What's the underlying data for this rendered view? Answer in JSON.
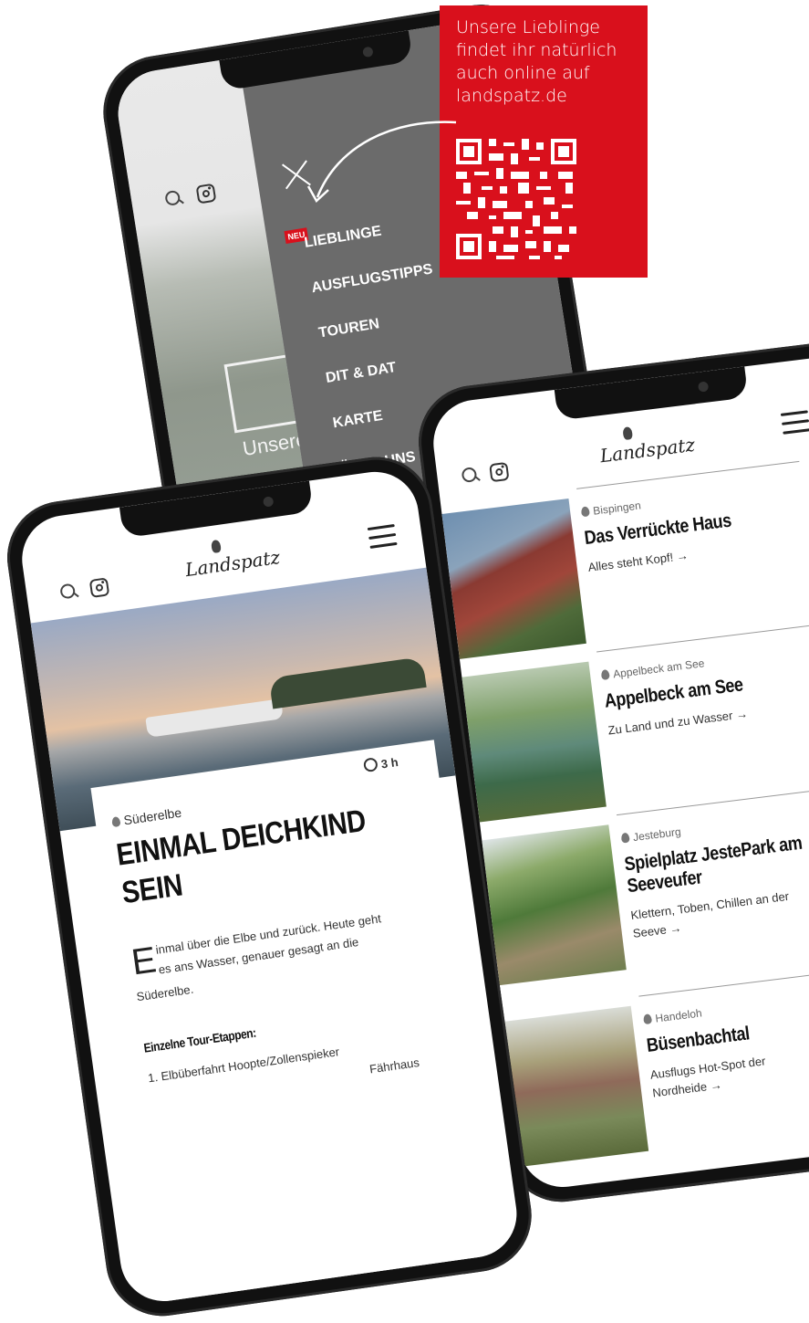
{
  "promo": {
    "text_lines": [
      "Unsere Lieblinge",
      "findet ihr natürlich",
      "auch online auf",
      "landspatz.de"
    ],
    "bg_color": "#d9101c"
  },
  "menu_phone": {
    "close_icon": "close-icon",
    "new_badge": "NEU",
    "items": [
      "LIEBLINGE",
      "AUSFLUGSTIPPS",
      "TOUREN",
      "DIT & DAT",
      "KARTE",
      "ÜBER UNS"
    ],
    "behind_text": "Unsere",
    "menu_bg": "#6b6b6b"
  },
  "tour_phone": {
    "logo": "Landspatz",
    "duration": "3 h",
    "location": "Süderelbe",
    "title_line1": "EINMAL DEICHKIND",
    "title_line2": "SEIN",
    "dropcap": "E",
    "intro_line1": "inmal über die Elbe und zurück. Heute geht",
    "intro_line2": "es ans Wasser, genauer gesagt an die",
    "intro_line3": "Süderelbe.",
    "stages_heading": "Einzelne Tour-Etappen:",
    "stage_1": "1.  Elbüberfahrt Hoopte/Zollenspieker",
    "stage_2_partial": "Fährhaus"
  },
  "list_phone": {
    "logo": "Landspatz",
    "entries": [
      {
        "location": "Bispingen",
        "title": "Das Verrückte Haus",
        "title2": "",
        "teaser": "Alles steht Kopf! →",
        "teaser2": ""
      },
      {
        "location": "Appelbeck am See",
        "title": "Appelbeck am See",
        "title2": "",
        "teaser": "Zu Land und zu Wasser →",
        "teaser2": ""
      },
      {
        "location": "Jesteburg",
        "title": "Spielplatz JestePark am",
        "title2": "Seeveufer",
        "teaser": "Klettern, Toben, Chillen an der",
        "teaser2": "Seeve →"
      },
      {
        "location": "Handeloh",
        "title": "Büsenbachtal",
        "title2": "",
        "teaser": "Ausflugs Hot-Spot der",
        "teaser2": "Nordheide →"
      }
    ]
  }
}
